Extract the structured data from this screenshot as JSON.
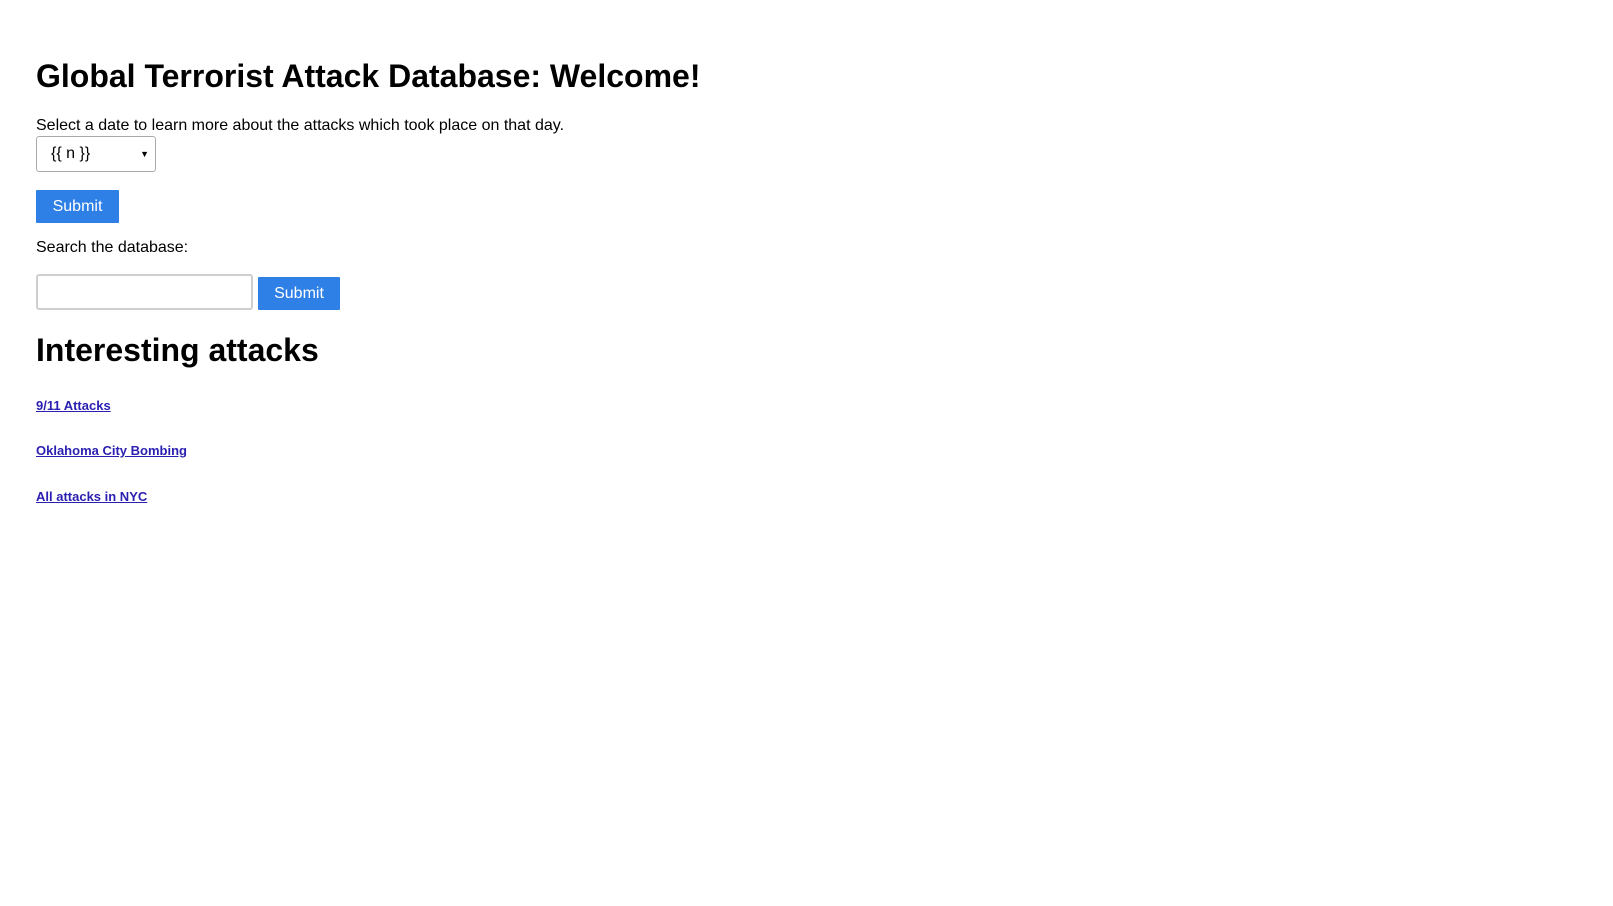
{
  "header": {
    "title": "Global Terrorist Attack Database: Welcome!"
  },
  "date_form": {
    "instructions": "Select a date to learn more about the attacks which took place on that day.",
    "select_value": "{{ n }}",
    "submit_label": "Submit"
  },
  "search_form": {
    "label": "Search the database:",
    "input_value": "",
    "input_placeholder": "",
    "submit_label": "Submit"
  },
  "interesting": {
    "title": "Interesting attacks",
    "links": [
      {
        "label": "9/11 Attacks"
      },
      {
        "label": "Oklahoma City Bombing"
      },
      {
        "label": "All attacks in NYC"
      }
    ]
  },
  "colors": {
    "button_bg": "#2e7fe6",
    "button_text": "#ffffff",
    "link": "#2a1fb0"
  },
  "icons": {
    "select_arrow": "chevron-down-icon"
  }
}
